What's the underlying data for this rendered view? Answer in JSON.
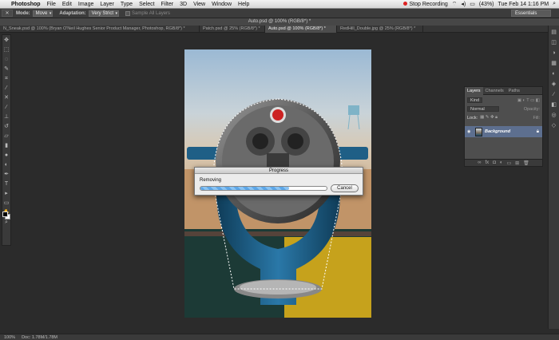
{
  "menubar": {
    "app_name": "Photoshop",
    "items": [
      "File",
      "Edit",
      "Image",
      "Layer",
      "Type",
      "Select",
      "Filter",
      "3D",
      "View",
      "Window",
      "Help"
    ],
    "recording": "Stop Recording",
    "battery": "(43%)",
    "clock": "Tue Feb 14  1:16 PM"
  },
  "options": {
    "mode_label": "Mode:",
    "mode_value": "Move",
    "adaptation_label": "Adaptation:",
    "adaptation_value": "Very Strict",
    "sample_all_layers": "Sample All Layers",
    "workspace": "Essentials"
  },
  "document": {
    "title": "Auto.psd @ 100% (RGB/8*) *"
  },
  "tabs": [
    {
      "label": "N_Sneak.psd @ 100% (Bryan O'Neil Hughes Senior Product Manager, Photoshop, RGB/8*) *"
    },
    {
      "label": "Patch.psd @ 25% (RGB/8*) *"
    },
    {
      "label": "Auto.psd @ 100% (RGB/8*) *"
    },
    {
      "label": "RedHill_Double.jpg @ 25% (RGB/8*) *"
    }
  ],
  "layers_panel": {
    "tabs": [
      "Layers",
      "Channels",
      "Paths"
    ],
    "kind_label": "Kind",
    "blend_mode": "Normal",
    "opacity_label": "Opacity:",
    "lock_label": "Lock:",
    "fill_label": "Fill:",
    "layer_name": "Background"
  },
  "progress": {
    "title": "Progress",
    "message": "Removing",
    "value": 0.7,
    "cancel_label": "Cancel"
  },
  "status": {
    "zoom": "100%",
    "doc_info": "Doc: 1.78M/1.78M"
  },
  "colors": {
    "progress_fill": "#5da7e8",
    "selected_layer": "#5d6f8f",
    "binocular_blue": "#1f5f86"
  }
}
